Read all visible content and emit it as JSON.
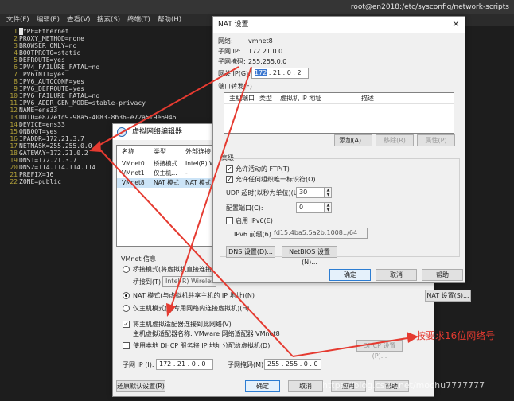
{
  "terminal": {
    "title": "root@en2018:/etc/sysconfig/network-scripts",
    "menu": [
      "文件(F)",
      "编辑(E)",
      "查看(V)",
      "搜索(S)",
      "终端(T)",
      "帮助(H)"
    ],
    "lines": [
      {
        "n": "1",
        "key": "TYPE",
        "val": "Ethernet"
      },
      {
        "n": "2",
        "key": "PROXY_METHOD",
        "val": "none"
      },
      {
        "n": "3",
        "key": "BROWSER_ONLY",
        "val": "no"
      },
      {
        "n": "4",
        "key": "BOOTPROTO",
        "val": "static"
      },
      {
        "n": "5",
        "key": "DEFROUTE",
        "val": "yes"
      },
      {
        "n": "6",
        "key": "IPV4_FAILURE_FATAL",
        "val": "no"
      },
      {
        "n": "7",
        "key": "IPV6INIT",
        "val": "yes"
      },
      {
        "n": "8",
        "key": "IPV6_AUTOCONF",
        "val": "yes"
      },
      {
        "n": "9",
        "key": "IPV6_DEFROUTE",
        "val": "yes"
      },
      {
        "n": "10",
        "key": "IPV6_FAILURE_FATAL",
        "val": "no"
      },
      {
        "n": "11",
        "key": "IPV6_ADDR_GEN_MODE",
        "val": "stable-privacy"
      },
      {
        "n": "12",
        "key": "NAME",
        "val": "ens33"
      },
      {
        "n": "13",
        "key": "UUID",
        "val": "e872efd9-98a5-4083-8b36-e72a5f9e6946"
      },
      {
        "n": "14",
        "key": "DEVICE",
        "val": "ens33"
      },
      {
        "n": "15",
        "key": "ONBOOT",
        "val": "yes"
      },
      {
        "n": "16",
        "key": "IPADDR",
        "val": "172.21.3.7"
      },
      {
        "n": "17",
        "key": "NETMASK",
        "val": "255.255.0.0"
      },
      {
        "n": "18",
        "key": "GATEWAY",
        "val": "172.21.0.2"
      },
      {
        "n": "19",
        "key": "DNS1",
        "val": "172.21.3.7"
      },
      {
        "n": "20",
        "key": "DNS2",
        "val": "114.114.114.114"
      },
      {
        "n": "21",
        "key": "PREFIX",
        "val": "16"
      },
      {
        "n": "22",
        "key": "ZONE",
        "val": "public"
      }
    ]
  },
  "vne": {
    "title": "虚拟网络编辑器",
    "columns": [
      "名称",
      "类型",
      "外部连接"
    ],
    "rows": [
      {
        "name": "VMnet0",
        "type": "桥接模式",
        "ext": "Intel(R) Wire"
      },
      {
        "name": "VMnet1",
        "type": "仅主机...",
        "ext": "-"
      },
      {
        "name": "VMnet8",
        "type": "NAT 模式",
        "ext": "NAT 模式"
      }
    ],
    "info_label": "VMnet 信息",
    "bridge_radio": "桥接模式(将虚拟机直接连接到",
    "bridge_to_label": "桥接到(T):",
    "bridge_to_value": "Intel(R) Wireless-AC",
    "nat_radio": "NAT 模式(与虚拟机共享主机的 IP 地址)(N)",
    "nat_settings_btn": "NAT 设置(S)...",
    "hostonly_radio": "仅主机模式(在专用网络内连接虚拟机)(H)",
    "connect_adapter_chk": "将主机虚拟适配器连接到此网络(V)",
    "adapter_name": "主机虚拟适配器名称: VMware 网络适配器 VMnet8",
    "dhcp_chk": "使用本地 DHCP 服务将 IP 地址分配给虚拟机(D)",
    "dhcp_settings_btn": "DHCP 设置(P)...",
    "subnet_ip_label": "子网 IP (I):",
    "subnet_ip_value": "172 . 21 . 0 . 0",
    "subnet_mask_label": "子网掩码(M):",
    "subnet_mask_value": "255 . 255 . 0 . 0",
    "restore_btn": "还原默认设置(R)",
    "ok_btn": "确定",
    "cancel_btn": "取消",
    "apply_btn": "应用",
    "help_btn": "帮助"
  },
  "nat": {
    "title": "NAT 设置",
    "network_label": "网络:",
    "network_value": "vmnet8",
    "subnet_ip_label": "子网 IP:",
    "subnet_ip_value": "172.21.0.0",
    "subnet_mask_label": "子网掩码:",
    "subnet_mask_value": "255.255.0.0",
    "gateway_label": "网关 IP(G):",
    "gateway_value_sel": "172",
    "gateway_value_rest": " . 21 . 0 . 2",
    "port_fwd_label": "端口转发(F)",
    "pf_columns": [
      "主机端口",
      "类型",
      "虚拟机 IP 地址",
      "描述"
    ],
    "add_btn": "添加(A)...",
    "remove_btn": "移除(R)",
    "props_btn": "属性(P)",
    "advanced_label": "高级",
    "ftp_chk": "允许活动的 FTP(T)",
    "oui_chk": "允许任何组织唯一标识符(O)",
    "udp_label": "UDP 超时(以秒为单位)(U):",
    "udp_value": "30",
    "config_port_label": "配置端口(C):",
    "config_port_value": "0",
    "ipv6_chk": "启用 IPv6(E)",
    "ipv6_prefix_label": "IPv6 前缀(6):",
    "ipv6_prefix_value": "fd15:4ba5:5a2b:1008::/64",
    "dns_btn": "DNS 设置(D)...",
    "netbios_btn": "NetBIOS 设置(N)...",
    "ok_btn": "确定",
    "cancel_btn": "取消",
    "help_btn": "帮助"
  },
  "annotation": {
    "text": "按要求16位网络号",
    "color": "#e53a30"
  },
  "watermark": "https://blog.csdn.net/mochu7777777"
}
